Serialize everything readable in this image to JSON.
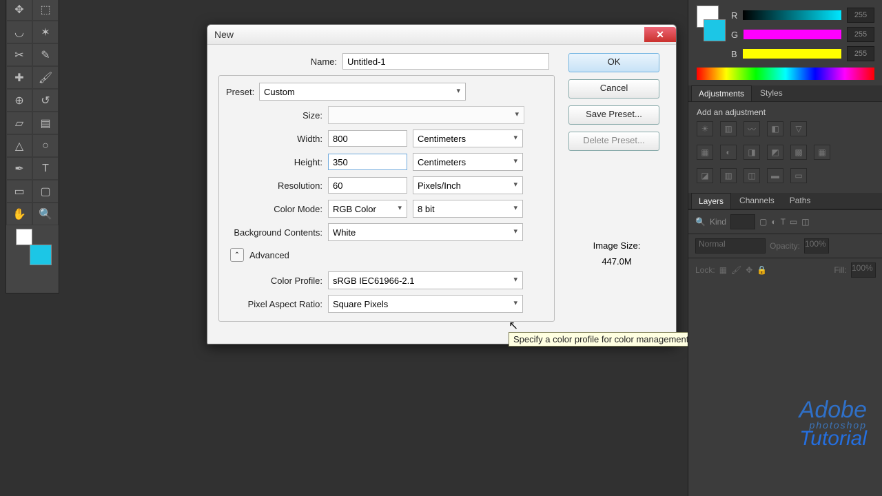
{
  "dialog": {
    "title": "New",
    "name_label": "Name:",
    "name_value": "Untitled-1",
    "preset_label": "Preset:",
    "preset_value": "Custom",
    "size_label": "Size:",
    "size_value": "",
    "width_label": "Width:",
    "width_value": "800",
    "width_unit": "Centimeters",
    "height_label": "Height:",
    "height_value": "350",
    "height_unit": "Centimeters",
    "resolution_label": "Resolution:",
    "resolution_value": "60",
    "resolution_unit": "Pixels/Inch",
    "color_mode_label": "Color Mode:",
    "color_mode_value": "RGB Color",
    "color_depth_value": "8 bit",
    "bg_label": "Background Contents:",
    "bg_value": "White",
    "advanced_label": "Advanced",
    "color_profile_label": "Color Profile:",
    "color_profile_value": "sRGB IEC61966-2.1",
    "pixel_ar_label": "Pixel Aspect Ratio:",
    "pixel_ar_value": "Square Pixels",
    "image_size_label": "Image Size:",
    "image_size_value": "447.0M",
    "btn_ok": "OK",
    "btn_cancel": "Cancel",
    "btn_save_preset": "Save Preset...",
    "btn_delete_preset": "Delete Preset...",
    "tooltip": "Specify a color profile for color management"
  },
  "rightpanel": {
    "r_label": "R",
    "g_label": "G",
    "b_label": "B",
    "val": "255",
    "adjustments_tab": "Adjustments",
    "styles_tab": "Styles",
    "add_adjustment": "Add an adjustment",
    "layers_tab": "Layers",
    "channels_tab": "Channels",
    "paths_tab": "Paths",
    "kind_label": "Kind",
    "blend_mode": "Normal",
    "opacity_label": "Opacity:",
    "opacity_value": "100%",
    "lock_label": "Lock:",
    "fill_label": "Fill:",
    "fill_value": "100%"
  },
  "watermark": {
    "l1": "Adobe",
    "l2": "photoshop",
    "l3": "Tutorial"
  }
}
